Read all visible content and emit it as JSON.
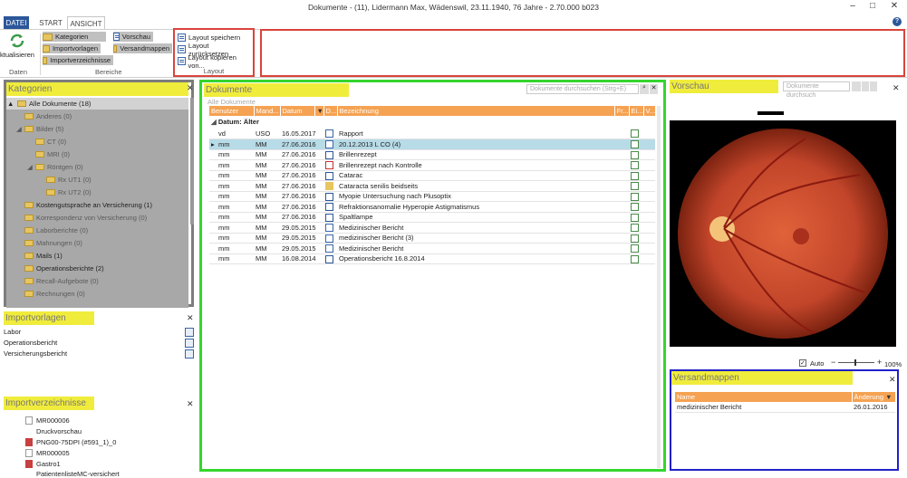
{
  "window": {
    "title": "Dokumente - (11), Lidermann Max, Wädenswil, 23.11.1940, 76 Jahre - 2.70.000 b023",
    "minimize": "–",
    "maximize": "□",
    "close": "✕"
  },
  "tabs": [
    {
      "label": "DATEI"
    },
    {
      "label": "START"
    },
    {
      "label": "ANSICHT"
    }
  ],
  "help": "?",
  "ribbon": {
    "refresh_label": "ktualisieren",
    "group_daten": "Daten",
    "group_bereiche": "Bereiche",
    "group_layout": "Layout",
    "bereiche": [
      "Kategorien",
      "Importvorlagen",
      "Importverzeichnisse",
      "Vorschau",
      "Versandmappen"
    ],
    "layout": [
      "Layout speichern",
      "Layout zurücksetzen",
      "Layout kopieren von..."
    ]
  },
  "kategorien": {
    "title": "Kategorien",
    "items": [
      {
        "label": "Alle Dokumente (18)",
        "level": 0,
        "expander": "▲"
      },
      {
        "label": "Anderes (0)",
        "level": 1,
        "expander": ""
      },
      {
        "label": "Bilder (5)",
        "level": 1,
        "expander": "◢"
      },
      {
        "label": "CT (0)",
        "level": 2,
        "expander": ""
      },
      {
        "label": "MRI (0)",
        "level": 2,
        "expander": ""
      },
      {
        "label": "Röntgen (0)",
        "level": 2,
        "expander": "◢"
      },
      {
        "label": "Rx UT1 (0)",
        "level": 3,
        "expander": ""
      },
      {
        "label": "Rx UT2 (0)",
        "level": 3,
        "expander": ""
      },
      {
        "label": "Kostengutsprache an Versicherung (1)",
        "level": 1,
        "expander": ""
      },
      {
        "label": "Korrespondenz von Versicherung (0)",
        "level": 1,
        "expander": ""
      },
      {
        "label": "Laborberichte (0)",
        "level": 1,
        "expander": ""
      },
      {
        "label": "Mahnungen (0)",
        "level": 1,
        "expander": ""
      },
      {
        "label": "Mails (1)",
        "level": 1,
        "expander": ""
      },
      {
        "label": "Operationsberichte (2)",
        "level": 1,
        "expander": ""
      },
      {
        "label": "Recall-Aufgebote (0)",
        "level": 1,
        "expander": ""
      },
      {
        "label": "Rechnungen (0)",
        "level": 1,
        "expander": ""
      }
    ]
  },
  "importvorlagen": {
    "title": "Importvorlagen",
    "items": [
      "Labor",
      "Operationsbericht",
      "Versicherungsbericht"
    ]
  },
  "importverzeichnisse": {
    "title": "Importverzeichnisse",
    "items": [
      "MR000006",
      "Druckvorschau",
      "PNG00-75DPI (#591_1)_0",
      "MR000005",
      "Gastro1",
      "PatientenlisteMC-versichert"
    ]
  },
  "dokumente": {
    "title": "Dokumente",
    "search_placeholder": "Dokumente durchsuchen (Strg+E)",
    "breadcrumb": "Alle Dokumente",
    "columns": [
      "Benutzer",
      "Mand...",
      "Datum",
      "▼",
      "D...",
      "Bezeichnung",
      "Fr...",
      "Ei...",
      "V..."
    ],
    "group_label": "Datum: Älter",
    "rows": [
      {
        "benutzer": "vd",
        "mand": "USO",
        "datum": "16.05.2017",
        "bez": "Rapport",
        "icon": "doc"
      },
      {
        "benutzer": "mm",
        "mand": "MM",
        "datum": "27.06.2016",
        "bez": "20.12.2013 L CO (4)",
        "icon": "scan"
      },
      {
        "benutzer": "mm",
        "mand": "MM",
        "datum": "27.06.2016",
        "bez": "Brillenrezept",
        "icon": "word"
      },
      {
        "benutzer": "mm",
        "mand": "MM",
        "datum": "27.06.2016",
        "bez": "Brillenrezept nach Kontrolle",
        "icon": "pdf"
      },
      {
        "benutzer": "mm",
        "mand": "MM",
        "datum": "27.06.2016",
        "bez": "Catarac",
        "icon": "word"
      },
      {
        "benutzer": "mm",
        "mand": "MM",
        "datum": "27.06.2016",
        "bez": "Cataracta senilis beidseits",
        "icon": "folder"
      },
      {
        "benutzer": "mm",
        "mand": "MM",
        "datum": "27.06.2016",
        "bez": "Myopie Untersuchung nach Plusoptix",
        "icon": "word"
      },
      {
        "benutzer": "mm",
        "mand": "MM",
        "datum": "27.06.2016",
        "bez": "Refraktionsanomalie Hyperopie Astigmatismus",
        "icon": "word"
      },
      {
        "benutzer": "mm",
        "mand": "MM",
        "datum": "27.06.2016",
        "bez": "Spaltlampe",
        "icon": "word"
      },
      {
        "benutzer": "mm",
        "mand": "MM",
        "datum": "29.05.2015",
        "bez": "Medizinischer Bericht",
        "icon": "doc"
      },
      {
        "benutzer": "mm",
        "mand": "MM",
        "datum": "29.05.2015",
        "bez": "medizinischer Bericht (3)",
        "icon": "scan"
      },
      {
        "benutzer": "mm",
        "mand": "MM",
        "datum": "29.05.2015",
        "bez": "Medizinischer Bericht",
        "icon": "doc"
      },
      {
        "benutzer": "mm",
        "mand": "MM",
        "datum": "16.08.2014",
        "bez": "Operationsbericht 16.8.2014",
        "icon": "word"
      }
    ]
  },
  "vorschau": {
    "title": "Vorschau",
    "search_placeholder": "Dokumente durchsuch",
    "auto_label": "Auto",
    "zoom": "100%"
  },
  "versandmappen": {
    "title": "Versandmappen",
    "columns": [
      "Name",
      "Änderung"
    ],
    "rows": [
      {
        "name": "medizinischer Bericht",
        "date": "26.01.2016"
      }
    ]
  },
  "colors": {
    "accent": "#f5a252",
    "highlight": "#f0ec3c",
    "green": "#34d62e",
    "red": "#d9443c",
    "blue": "#2020c8"
  }
}
